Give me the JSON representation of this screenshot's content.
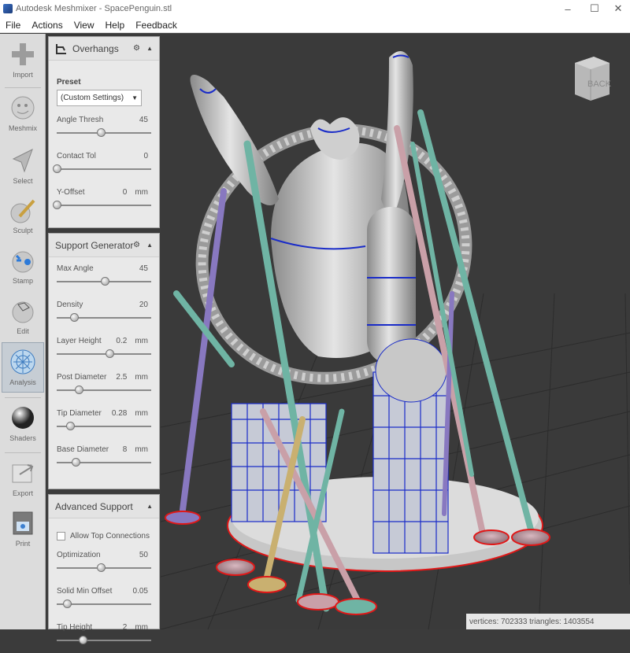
{
  "window": {
    "title": "Autodesk Meshmixer - SpacePenguin.stl",
    "controls": [
      "minimize-icon",
      "maximize-icon",
      "close-icon"
    ]
  },
  "menu": [
    "File",
    "Actions",
    "View",
    "Help",
    "Feedback"
  ],
  "toolbar": [
    {
      "label": "Import",
      "icon": "plus-icon"
    },
    {
      "label": "Meshmix",
      "icon": "meshmix-icon"
    },
    {
      "label": "Select",
      "icon": "cursor-icon"
    },
    {
      "label": "Sculpt",
      "icon": "brush-icon"
    },
    {
      "label": "Stamp",
      "icon": "stamp-icon"
    },
    {
      "label": "Edit",
      "icon": "edit-icon"
    },
    {
      "label": "Analysis",
      "icon": "analysis-icon"
    },
    {
      "label": "Shaders",
      "icon": "sphere-icon"
    },
    {
      "label": "Export",
      "icon": "export-icon"
    },
    {
      "label": "Print",
      "icon": "printer-icon"
    }
  ],
  "overhangs": {
    "title": "Overhangs",
    "preset_label": "Preset",
    "preset_value": "(Custom Settings)",
    "rows": [
      {
        "label": "Angle Thresh",
        "value": "45",
        "unit": "",
        "level": 0.5
      },
      {
        "label": "Contact Tol",
        "value": "0",
        "unit": "",
        "level": 0.0
      },
      {
        "label": "Y-Offset",
        "value": "0",
        "unit": "mm",
        "level": 0.0
      }
    ]
  },
  "support_generator": {
    "title": "Support Generator",
    "rows": [
      {
        "label": "Max Angle",
        "value": "45",
        "unit": "",
        "level": 0.55
      },
      {
        "label": "Density",
        "value": "20",
        "unit": "",
        "level": 0.2
      },
      {
        "label": "Layer Height",
        "value": "0.2",
        "unit": "mm",
        "level": 0.6
      },
      {
        "label": "Post Diameter",
        "value": "2.5",
        "unit": "mm",
        "level": 0.25
      },
      {
        "label": "Tip Diameter",
        "value": "0.28",
        "unit": "mm",
        "level": 0.15
      },
      {
        "label": "Base Diameter",
        "value": "8",
        "unit": "mm",
        "level": 0.22
      }
    ]
  },
  "advanced_support": {
    "title": "Advanced Support",
    "checkbox_label": "Allow Top Connections",
    "rows": [
      {
        "label": "Optimization",
        "value": "50",
        "unit": "",
        "level": 0.5
      },
      {
        "label": "Solid Min Offset",
        "value": "0.05",
        "unit": "",
        "level": 0.12
      },
      {
        "label": "Tip Height",
        "value": "2",
        "unit": "mm",
        "level": 0.3
      }
    ]
  },
  "view_cube": {
    "label": "BACK"
  },
  "status": {
    "text": "vertices: 702333  triangles: 1403554"
  },
  "colors": {
    "support_pink": "#c9a0a8",
    "support_teal": "#6fb4a4",
    "support_purple": "#8878c0",
    "overhang_blue": "#1a2cc8",
    "base_red": "#e01818",
    "model": "#c8c8c8"
  }
}
